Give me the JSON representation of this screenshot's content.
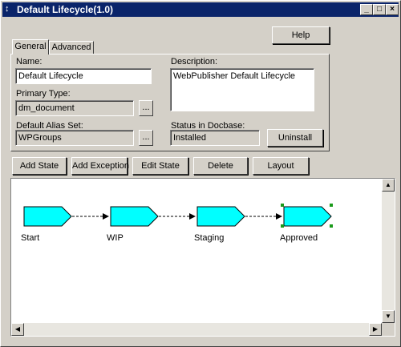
{
  "window": {
    "title": "Default Lifecycle(1.0)",
    "controls": [
      "minimize-icon",
      "maximize-icon",
      "close-icon"
    ]
  },
  "help_label": "Help",
  "tabs": [
    {
      "label": "General",
      "active": true
    },
    {
      "label": "Advanced",
      "active": false
    }
  ],
  "general": {
    "name_label": "Name:",
    "name_value": "Default Lifecycle",
    "description_label": "Description:",
    "description_value": "WebPublisher Default Lifecycle",
    "primary_type_label": "Primary Type:",
    "primary_type_value": "dm_document",
    "default_alias_label": "Default Alias Set:",
    "default_alias_value": "WPGroups",
    "status_label": "Status in Docbase:",
    "status_value": "Installed",
    "browse_label": "...",
    "uninstall_label": "Uninstall"
  },
  "toolbar": {
    "add_state": "Add State",
    "add_exception": "Add Exception",
    "edit_state": "Edit State",
    "delete": "Delete",
    "layout": "Layout"
  },
  "diagram": {
    "states": [
      {
        "label": "Start",
        "selected": false
      },
      {
        "label": "WIP",
        "selected": false
      },
      {
        "label": "Staging",
        "selected": false
      },
      {
        "label": "Approved",
        "selected": true
      }
    ],
    "fill_color": "#00ffff",
    "selection_color": "#1a9a1a"
  }
}
